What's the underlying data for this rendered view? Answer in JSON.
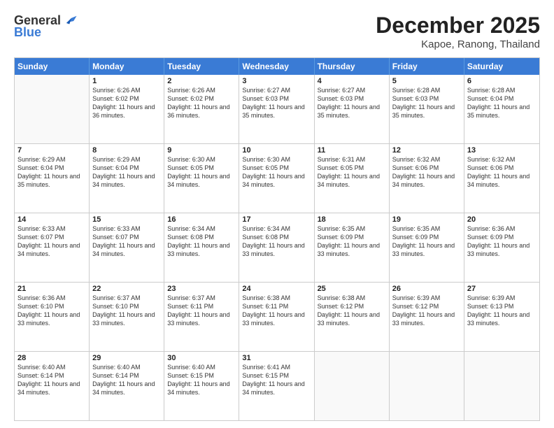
{
  "logo": {
    "general": "General",
    "blue": "Blue"
  },
  "title": "December 2025",
  "location": "Kapoe, Ranong, Thailand",
  "header_days": [
    "Sunday",
    "Monday",
    "Tuesday",
    "Wednesday",
    "Thursday",
    "Friday",
    "Saturday"
  ],
  "weeks": [
    [
      {
        "day": "",
        "empty": true
      },
      {
        "day": "1",
        "sunrise": "Sunrise: 6:26 AM",
        "sunset": "Sunset: 6:02 PM",
        "daylight": "Daylight: 11 hours and 36 minutes."
      },
      {
        "day": "2",
        "sunrise": "Sunrise: 6:26 AM",
        "sunset": "Sunset: 6:02 PM",
        "daylight": "Daylight: 11 hours and 36 minutes."
      },
      {
        "day": "3",
        "sunrise": "Sunrise: 6:27 AM",
        "sunset": "Sunset: 6:03 PM",
        "daylight": "Daylight: 11 hours and 35 minutes."
      },
      {
        "day": "4",
        "sunrise": "Sunrise: 6:27 AM",
        "sunset": "Sunset: 6:03 PM",
        "daylight": "Daylight: 11 hours and 35 minutes."
      },
      {
        "day": "5",
        "sunrise": "Sunrise: 6:28 AM",
        "sunset": "Sunset: 6:03 PM",
        "daylight": "Daylight: 11 hours and 35 minutes."
      },
      {
        "day": "6",
        "sunrise": "Sunrise: 6:28 AM",
        "sunset": "Sunset: 6:04 PM",
        "daylight": "Daylight: 11 hours and 35 minutes."
      }
    ],
    [
      {
        "day": "7",
        "sunrise": "Sunrise: 6:29 AM",
        "sunset": "Sunset: 6:04 PM",
        "daylight": "Daylight: 11 hours and 35 minutes."
      },
      {
        "day": "8",
        "sunrise": "Sunrise: 6:29 AM",
        "sunset": "Sunset: 6:04 PM",
        "daylight": "Daylight: 11 hours and 34 minutes."
      },
      {
        "day": "9",
        "sunrise": "Sunrise: 6:30 AM",
        "sunset": "Sunset: 6:05 PM",
        "daylight": "Daylight: 11 hours and 34 minutes."
      },
      {
        "day": "10",
        "sunrise": "Sunrise: 6:30 AM",
        "sunset": "Sunset: 6:05 PM",
        "daylight": "Daylight: 11 hours and 34 minutes."
      },
      {
        "day": "11",
        "sunrise": "Sunrise: 6:31 AM",
        "sunset": "Sunset: 6:05 PM",
        "daylight": "Daylight: 11 hours and 34 minutes."
      },
      {
        "day": "12",
        "sunrise": "Sunrise: 6:32 AM",
        "sunset": "Sunset: 6:06 PM",
        "daylight": "Daylight: 11 hours and 34 minutes."
      },
      {
        "day": "13",
        "sunrise": "Sunrise: 6:32 AM",
        "sunset": "Sunset: 6:06 PM",
        "daylight": "Daylight: 11 hours and 34 minutes."
      }
    ],
    [
      {
        "day": "14",
        "sunrise": "Sunrise: 6:33 AM",
        "sunset": "Sunset: 6:07 PM",
        "daylight": "Daylight: 11 hours and 34 minutes."
      },
      {
        "day": "15",
        "sunrise": "Sunrise: 6:33 AM",
        "sunset": "Sunset: 6:07 PM",
        "daylight": "Daylight: 11 hours and 34 minutes."
      },
      {
        "day": "16",
        "sunrise": "Sunrise: 6:34 AM",
        "sunset": "Sunset: 6:08 PM",
        "daylight": "Daylight: 11 hours and 33 minutes."
      },
      {
        "day": "17",
        "sunrise": "Sunrise: 6:34 AM",
        "sunset": "Sunset: 6:08 PM",
        "daylight": "Daylight: 11 hours and 33 minutes."
      },
      {
        "day": "18",
        "sunrise": "Sunrise: 6:35 AM",
        "sunset": "Sunset: 6:09 PM",
        "daylight": "Daylight: 11 hours and 33 minutes."
      },
      {
        "day": "19",
        "sunrise": "Sunrise: 6:35 AM",
        "sunset": "Sunset: 6:09 PM",
        "daylight": "Daylight: 11 hours and 33 minutes."
      },
      {
        "day": "20",
        "sunrise": "Sunrise: 6:36 AM",
        "sunset": "Sunset: 6:09 PM",
        "daylight": "Daylight: 11 hours and 33 minutes."
      }
    ],
    [
      {
        "day": "21",
        "sunrise": "Sunrise: 6:36 AM",
        "sunset": "Sunset: 6:10 PM",
        "daylight": "Daylight: 11 hours and 33 minutes."
      },
      {
        "day": "22",
        "sunrise": "Sunrise: 6:37 AM",
        "sunset": "Sunset: 6:10 PM",
        "daylight": "Daylight: 11 hours and 33 minutes."
      },
      {
        "day": "23",
        "sunrise": "Sunrise: 6:37 AM",
        "sunset": "Sunset: 6:11 PM",
        "daylight": "Daylight: 11 hours and 33 minutes."
      },
      {
        "day": "24",
        "sunrise": "Sunrise: 6:38 AM",
        "sunset": "Sunset: 6:11 PM",
        "daylight": "Daylight: 11 hours and 33 minutes."
      },
      {
        "day": "25",
        "sunrise": "Sunrise: 6:38 AM",
        "sunset": "Sunset: 6:12 PM",
        "daylight": "Daylight: 11 hours and 33 minutes."
      },
      {
        "day": "26",
        "sunrise": "Sunrise: 6:39 AM",
        "sunset": "Sunset: 6:12 PM",
        "daylight": "Daylight: 11 hours and 33 minutes."
      },
      {
        "day": "27",
        "sunrise": "Sunrise: 6:39 AM",
        "sunset": "Sunset: 6:13 PM",
        "daylight": "Daylight: 11 hours and 33 minutes."
      }
    ],
    [
      {
        "day": "28",
        "sunrise": "Sunrise: 6:40 AM",
        "sunset": "Sunset: 6:14 PM",
        "daylight": "Daylight: 11 hours and 34 minutes."
      },
      {
        "day": "29",
        "sunrise": "Sunrise: 6:40 AM",
        "sunset": "Sunset: 6:14 PM",
        "daylight": "Daylight: 11 hours and 34 minutes."
      },
      {
        "day": "30",
        "sunrise": "Sunrise: 6:40 AM",
        "sunset": "Sunset: 6:15 PM",
        "daylight": "Daylight: 11 hours and 34 minutes."
      },
      {
        "day": "31",
        "sunrise": "Sunrise: 6:41 AM",
        "sunset": "Sunset: 6:15 PM",
        "daylight": "Daylight: 11 hours and 34 minutes."
      },
      {
        "day": "",
        "empty": true
      },
      {
        "day": "",
        "empty": true
      },
      {
        "day": "",
        "empty": true
      }
    ]
  ]
}
